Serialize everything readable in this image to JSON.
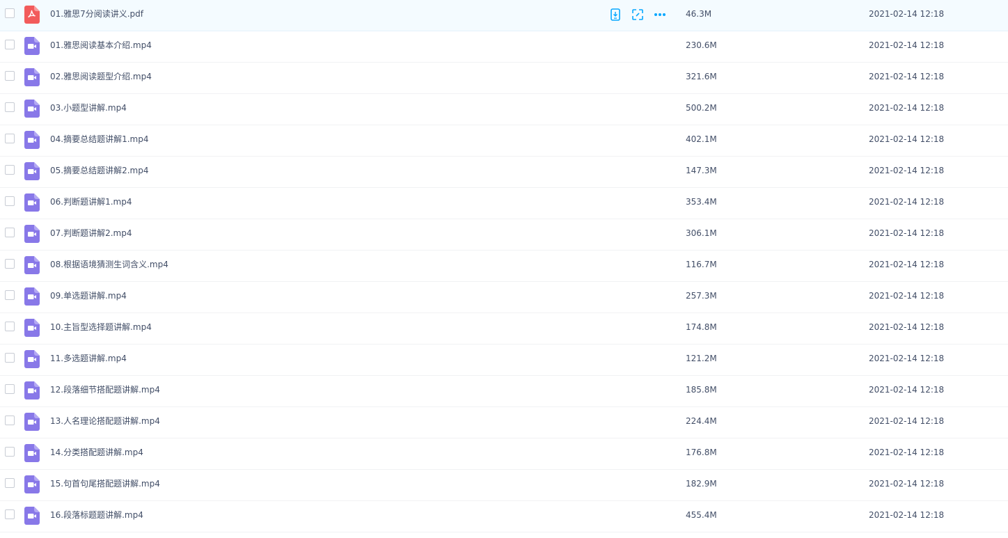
{
  "files": [
    {
      "name": "01.雅思7分阅读讲义.pdf",
      "type": "pdf",
      "size": "46.3M",
      "date": "2021-02-14 12:18",
      "hover": true
    },
    {
      "name": "01.雅思阅读基本介绍.mp4",
      "type": "video",
      "size": "230.6M",
      "date": "2021-02-14 12:18"
    },
    {
      "name": "02.雅思阅读题型介绍.mp4",
      "type": "video",
      "size": "321.6M",
      "date": "2021-02-14 12:18"
    },
    {
      "name": "03.小题型讲解.mp4",
      "type": "video",
      "size": "500.2M",
      "date": "2021-02-14 12:18"
    },
    {
      "name": "04.摘要总结题讲解1.mp4",
      "type": "video",
      "size": "402.1M",
      "date": "2021-02-14 12:18"
    },
    {
      "name": "05.摘要总结题讲解2.mp4",
      "type": "video",
      "size": "147.3M",
      "date": "2021-02-14 12:18"
    },
    {
      "name": "06.判断题讲解1.mp4",
      "type": "video",
      "size": "353.4M",
      "date": "2021-02-14 12:18"
    },
    {
      "name": "07.判断题讲解2.mp4",
      "type": "video",
      "size": "306.1M",
      "date": "2021-02-14 12:18"
    },
    {
      "name": "08.根据语境猜测生词含义.mp4",
      "type": "video",
      "size": "116.7M",
      "date": "2021-02-14 12:18"
    },
    {
      "name": "09.单选题讲解.mp4",
      "type": "video",
      "size": "257.3M",
      "date": "2021-02-14 12:18"
    },
    {
      "name": "10.主旨型选择题讲解.mp4",
      "type": "video",
      "size": "174.8M",
      "date": "2021-02-14 12:18"
    },
    {
      "name": "11.多选题讲解.mp4",
      "type": "video",
      "size": "121.2M",
      "date": "2021-02-14 12:18"
    },
    {
      "name": "12.段落细节搭配题讲解.mp4",
      "type": "video",
      "size": "185.8M",
      "date": "2021-02-14 12:18"
    },
    {
      "name": "13.人名理论搭配题讲解.mp4",
      "type": "video",
      "size": "224.4M",
      "date": "2021-02-14 12:18"
    },
    {
      "name": "14.分类搭配题讲解.mp4",
      "type": "video",
      "size": "176.8M",
      "date": "2021-02-14 12:18"
    },
    {
      "name": "15.句首句尾搭配题讲解.mp4",
      "type": "video",
      "size": "182.9M",
      "date": "2021-02-14 12:18"
    },
    {
      "name": "16.段落标题题讲解.mp4",
      "type": "video",
      "size": "455.4M",
      "date": "2021-02-14 12:18"
    }
  ],
  "row_actions": [
    "phone-transfer-icon",
    "share-link-icon",
    "more-icon"
  ],
  "colors": {
    "accent": "#06a7ff",
    "pdf": "#f25b5b",
    "video": "#8878e8",
    "hover_bg": "#f4fbff"
  }
}
